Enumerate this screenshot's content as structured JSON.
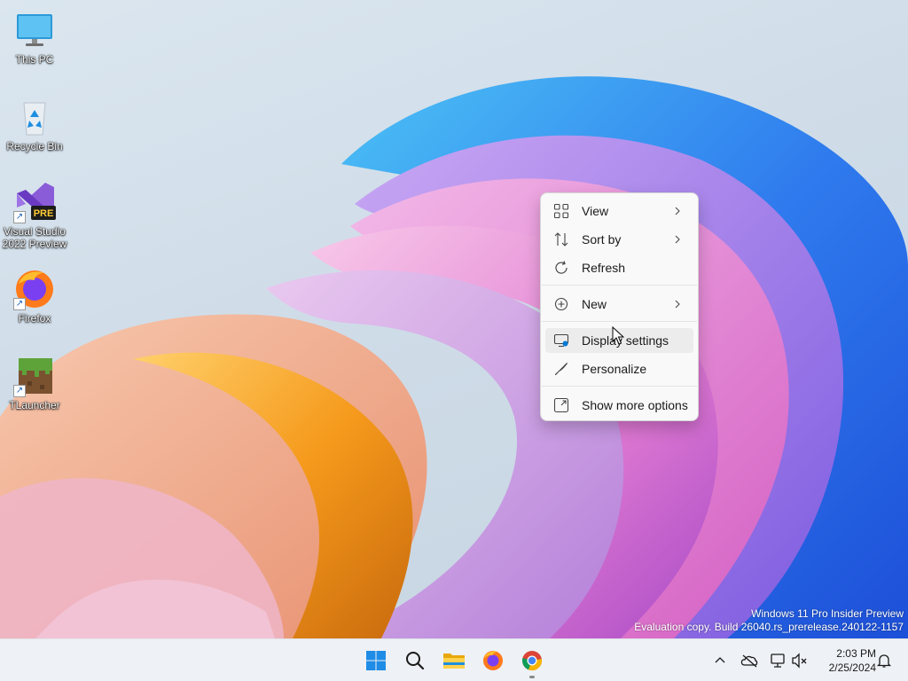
{
  "desktop": {
    "icons": [
      {
        "label": "This PC",
        "icon": "monitor-icon"
      },
      {
        "label": "Recycle Bin",
        "icon": "recycle-bin-icon"
      },
      {
        "label": "Visual Studio 2022 Preview",
        "icon": "visual-studio-icon",
        "badge": "PRE"
      },
      {
        "label": "Firefox",
        "icon": "firefox-icon"
      },
      {
        "label": "TLauncher",
        "icon": "grass-block-icon"
      }
    ],
    "watermark": {
      "line1": "Windows 11 Pro Insider Preview",
      "line2": "Evaluation copy. Build 26040.rs_prerelease.240122-1157"
    }
  },
  "context_menu": {
    "items": [
      {
        "label": "View",
        "icon": "grid-icon",
        "submenu": true
      },
      {
        "label": "Sort by",
        "icon": "sort-icon",
        "submenu": true
      },
      {
        "label": "Refresh",
        "icon": "refresh-icon",
        "submenu": false
      },
      {
        "label": "New",
        "icon": "plus-circle-icon",
        "submenu": true
      },
      {
        "label": "Display settings",
        "icon": "display-settings-icon",
        "submenu": false,
        "hovered": true
      },
      {
        "label": "Personalize",
        "icon": "brush-icon",
        "submenu": false
      },
      {
        "label": "Show more options",
        "icon": "expand-icon",
        "submenu": false
      }
    ]
  },
  "taskbar": {
    "apps": [
      "start-icon",
      "search-icon",
      "file-explorer-icon",
      "firefox-icon",
      "chrome-icon"
    ],
    "tray_icons": [
      "chevron-up-icon",
      "onedrive-offline-icon",
      "network-icon",
      "volume-muted-icon",
      "notifications-icon"
    ],
    "time": "2:03 PM",
    "date": "2/25/2024"
  },
  "colors": {
    "accent": "#0078d4",
    "menu_bg": "#f9f9f9",
    "taskbar_bg": "#eef1f5"
  }
}
